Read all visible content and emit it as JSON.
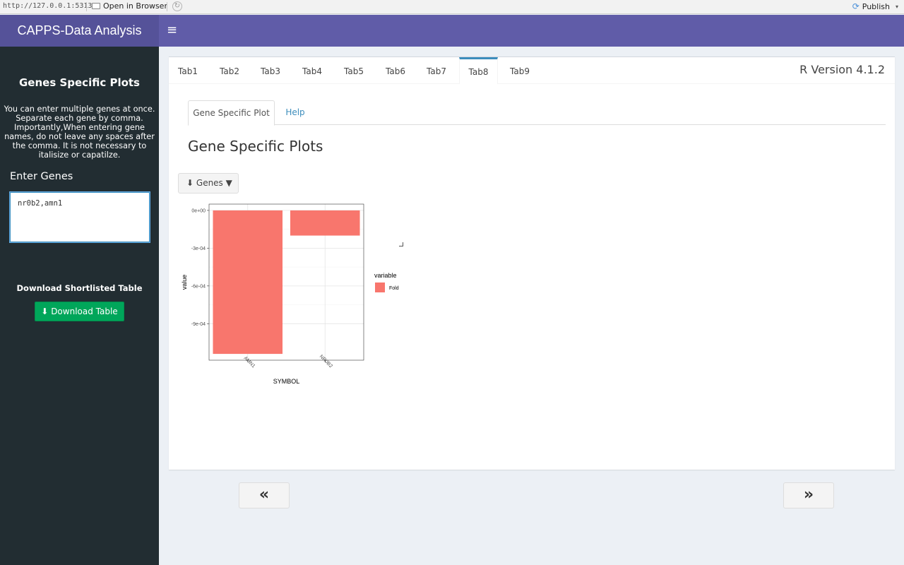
{
  "viewer": {
    "url": "http://127.0.0.1:5313",
    "open_in_browser": "Open in Browser",
    "publish": "Publish"
  },
  "header": {
    "app_title": "CAPPS-Data Analysis",
    "menu_icon": "hamburger-icon"
  },
  "sidebar": {
    "title": "Genes Specific Plots",
    "instructions": "You can enter multiple genes at once. Separate each gene by comma. Importantly,When entering gene names, do not leave any spaces after the comma. It is not necessary to italisize or capatilze.",
    "enter_genes_label": "Enter Genes",
    "genes_value": "nr0b2,amn1",
    "download_label": "Download Shortlisted Table",
    "download_button": "Download Table"
  },
  "main": {
    "tabs": [
      {
        "label": "Tab1",
        "active": false
      },
      {
        "label": "Tab2",
        "active": false
      },
      {
        "label": "Tab3",
        "active": false
      },
      {
        "label": "Tab4",
        "active": false
      },
      {
        "label": "Tab5",
        "active": false
      },
      {
        "label": "Tab6",
        "active": false
      },
      {
        "label": "Tab7",
        "active": false
      },
      {
        "label": "Tab8",
        "active": true
      },
      {
        "label": "Tab9",
        "active": false
      }
    ],
    "r_version": "R Version 4.1.2",
    "subtabs": [
      {
        "label": "Gene Specific Plot",
        "active": true
      },
      {
        "label": "Help",
        "active": false
      }
    ],
    "heading": "Gene Specific Plots",
    "genes_dropdown": "Genes"
  },
  "pager": {
    "prev": "«",
    "next": "»"
  },
  "colors": {
    "header": "#605ca8",
    "logo_bg": "#555299",
    "sidebar": "#222d32",
    "download_green": "#00a65a",
    "bar_fill": "#F8766D",
    "active_tab": "#3c8dbc"
  },
  "chart_data": {
    "type": "bar",
    "categories": [
      "AMN1",
      "NR0B2"
    ],
    "series": [
      {
        "name": "Fold",
        "values": [
          -0.00114,
          -0.0002
        ]
      }
    ],
    "xlabel": "SYMBOL",
    "ylabel": "value",
    "yticks": [
      "0e+00",
      "-3e-04",
      "-6e-04",
      "-9e-04"
    ],
    "ytick_values": [
      0,
      -0.0003,
      -0.0006,
      -0.0009
    ],
    "ylim": [
      -0.00119,
      5e-05
    ],
    "legend_title": "variable",
    "legend_placement": "right",
    "grid": true
  }
}
